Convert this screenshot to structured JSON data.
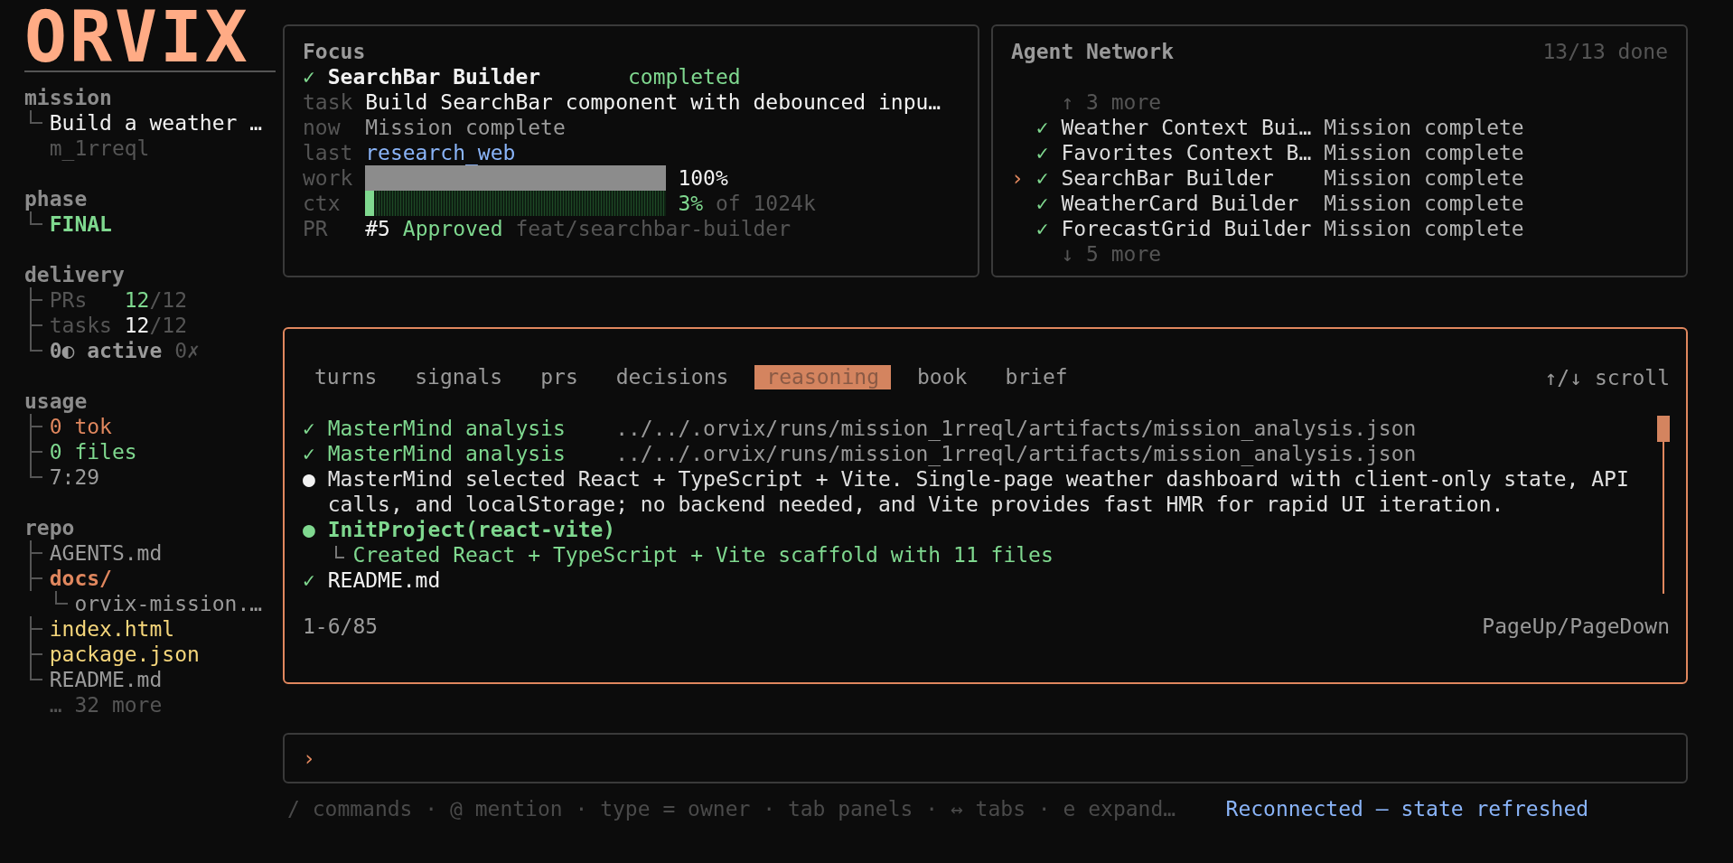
{
  "sidebar": {
    "logo": "ORVIX",
    "sections": [
      {
        "label": "mission",
        "rows": [
          {
            "kind": "item",
            "parts": [
              {
                "text": "Build a weather …",
                "color": "#f2f2f2"
              }
            ]
          },
          {
            "kind": "note",
            "parts": [
              {
                "text": "m_1rreql",
                "color": "#555555"
              }
            ]
          }
        ]
      },
      {
        "label": "phase",
        "rows": [
          {
            "kind": "item",
            "parts": [
              {
                "text": "FINAL",
                "color": "#7fd88f",
                "bold": true
              }
            ]
          }
        ]
      },
      {
        "label": "delivery",
        "rows": [
          {
            "kind": "item",
            "label": "PRs",
            "parts": [
              {
                "text": "12",
                "color": "#7fd88f"
              },
              {
                "text": "/12",
                "color": "#555555",
                "attached": true
              }
            ]
          },
          {
            "kind": "item",
            "label": "tasks",
            "parts": [
              {
                "text": "12",
                "color": "#f2f2f2"
              },
              {
                "text": "/12",
                "color": "#555555",
                "attached": true
              }
            ]
          },
          {
            "kind": "item",
            "parts": [
              {
                "text": "0◐ active",
                "color": "#9a9a9a",
                "bold": true
              },
              {
                "text": "0✗",
                "color": "#555555"
              }
            ]
          }
        ]
      },
      {
        "label": "usage",
        "rows": [
          {
            "kind": "item",
            "parts": [
              {
                "text": "0 tok",
                "color": "#e0875e"
              }
            ]
          },
          {
            "kind": "item",
            "parts": [
              {
                "text": "0 files",
                "color": "#7fd88f"
              }
            ]
          },
          {
            "kind": "item",
            "parts": [
              {
                "text": "7:29",
                "color": "#9a9a9a"
              }
            ]
          }
        ]
      },
      {
        "label": "repo",
        "rows": [
          {
            "kind": "item",
            "parts": [
              {
                "text": "AGENTS.md",
                "color": "#9a9a9a"
              }
            ]
          },
          {
            "kind": "item",
            "parts": [
              {
                "text": "docs/",
                "color": "#e0875e",
                "bold": true
              }
            ],
            "children": [
              {
                "kind": "item",
                "parts": [
                  {
                    "text": "orvix-mission.…",
                    "color": "#9a9a9a"
                  }
                ]
              }
            ]
          },
          {
            "kind": "item",
            "parts": [
              {
                "text": "index.html",
                "color": "#f5d67b"
              }
            ]
          },
          {
            "kind": "item",
            "parts": [
              {
                "text": "package.json",
                "color": "#f5d67b"
              }
            ]
          },
          {
            "kind": "item",
            "parts": [
              {
                "text": "README.md",
                "color": "#9a9a9a"
              }
            ]
          },
          {
            "kind": "note",
            "parts": [
              {
                "text": "… 32 more",
                "color": "#555555"
              }
            ]
          }
        ]
      }
    ]
  },
  "focus": {
    "title": "Focus",
    "check": "✓",
    "name": "SearchBar Builder",
    "status": "completed",
    "fields": [
      {
        "kind": "text",
        "label": "task",
        "parts": [
          {
            "text": "Build SearchBar component with debounced inpu…",
            "color": "#f2f2f2"
          }
        ]
      },
      {
        "kind": "text",
        "label": "now",
        "parts": [
          {
            "text": "Mission complete",
            "color": "#9a9a9a"
          }
        ]
      },
      {
        "kind": "text",
        "label": "last",
        "parts": [
          {
            "text": "research_web",
            "color": "#8ab4f8"
          }
        ]
      },
      {
        "kind": "bar",
        "label": "work",
        "level": 1,
        "color": "#8c8c8c",
        "parts": [
          {
            "text": "100%",
            "color": "#f2f2f2"
          }
        ]
      },
      {
        "kind": "bar",
        "label": "ctx",
        "level": 0.03,
        "color": "#7fd88f",
        "parts": [
          {
            "text": "3%",
            "color": "#7fd88f"
          },
          {
            "text": "of 1024k",
            "color": "#555555"
          }
        ]
      },
      {
        "kind": "text",
        "label": "PR",
        "parts": [
          {
            "text": "#5",
            "color": "#f2f2f2"
          },
          {
            "text": "Approved",
            "color": "#7fd88f"
          },
          {
            "text": "feat/searchbar-builder",
            "color": "#555555"
          }
        ]
      }
    ]
  },
  "agent_network": {
    "title": "Agent Network",
    "summary": "13/13 done",
    "selected_marker": "›",
    "more_above": "↑ 3 more",
    "more_below": "↓ 5 more",
    "agents": [
      {
        "check": "✓",
        "name": "Weather Context Bui…",
        "status": "Mission complete",
        "selected": false
      },
      {
        "check": "✓",
        "name": "Favorites Context B…",
        "status": "Mission complete",
        "selected": false
      },
      {
        "check": "✓",
        "name": "SearchBar Builder",
        "status": "Mission complete",
        "selected": true
      },
      {
        "check": "✓",
        "name": "WeatherCard Builder",
        "status": "Mission complete",
        "selected": false
      },
      {
        "check": "✓",
        "name": "ForecastGrid Builder",
        "status": "Mission complete",
        "selected": false
      }
    ]
  },
  "activity": {
    "tabs": [
      {
        "label": "turns",
        "selected": false
      },
      {
        "label": "signals",
        "selected": false
      },
      {
        "label": "prs",
        "selected": false
      },
      {
        "label": "decisions",
        "selected": false
      },
      {
        "label": "reasoning",
        "selected": true
      },
      {
        "label": "book",
        "selected": false
      },
      {
        "label": "brief",
        "selected": false
      }
    ],
    "scroll_hint": "↑/↓ scroll",
    "entries": [
      {
        "kind": "row",
        "mark": {
          "glyph": "✓",
          "color": "#7fd88f"
        },
        "title": "MasterMind analysis",
        "color": "#7fd88f",
        "detail": "../../.orvix/runs/mission_1rreql/artifacts/mission_analysis.json"
      },
      {
        "kind": "row",
        "mark": {
          "glyph": "✓",
          "color": "#7fd88f"
        },
        "title": "MasterMind analysis",
        "color": "#7fd88f",
        "detail": "../../.orvix/runs/mission_1rreql/artifacts/mission_analysis.json"
      },
      {
        "kind": "text",
        "mark": {
          "glyph": "●",
          "color": "#f2f2f2"
        },
        "title": "MasterMind selected React + TypeScript + Vite. Single-page weather dashboard with client-only state, API calls, and localStorage; no backend needed, and Vite provides fast HMR for rapid UI iteration.",
        "color": "#e0e0e0"
      },
      {
        "kind": "tool",
        "mark": {
          "glyph": "●",
          "color": "#7fd88f"
        },
        "title": "InitProject(react-vite)",
        "color": "#7fd88f",
        "children": [
          "Created React + TypeScript + Vite scaffold with 11 files"
        ]
      },
      {
        "kind": "row",
        "mark": {
          "glyph": "✓",
          "color": "#7fd88f"
        },
        "title": "README.md",
        "color": "#f2f2f2"
      }
    ],
    "range": "1-6/85",
    "paging_hint": "PageUp/PageDown"
  },
  "prompt": {
    "symbol": "›"
  },
  "footer": {
    "hints": "/ commands · @ mention · type = owner · tab panels · ↔ tabs · e expand…",
    "status": "Reconnected — state refreshed"
  }
}
